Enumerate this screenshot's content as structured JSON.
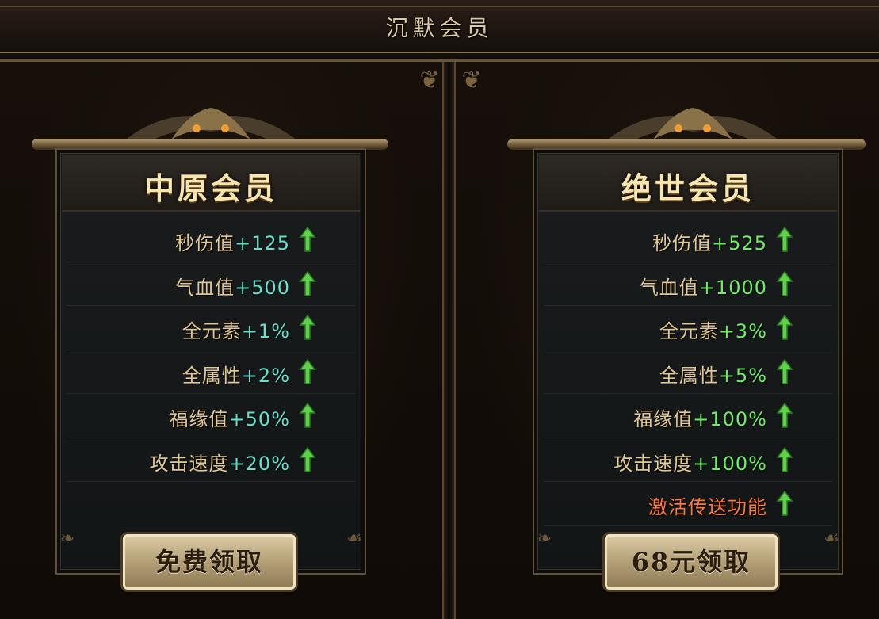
{
  "window": {
    "title": "沉默会员"
  },
  "colors": {
    "accent": "#e2c893",
    "value_cyan": "#61e3cf",
    "value_green": "#6ef065",
    "special": "#ff7a3a"
  },
  "panels": [
    {
      "title": "中原会员",
      "stats": [
        {
          "label": "秒伤值",
          "value": "+125"
        },
        {
          "label": "气血值",
          "value": "+500"
        },
        {
          "label": "全元素",
          "value": "+1%"
        },
        {
          "label": "全属性",
          "value": "+2%"
        },
        {
          "label": "福缘值",
          "value": "+50%"
        },
        {
          "label": "攻击速度",
          "value": "+20%"
        }
      ],
      "button_label": "免费领取"
    },
    {
      "title": "绝世会员",
      "stats": [
        {
          "label": "秒伤值",
          "value": "+525"
        },
        {
          "label": "气血值",
          "value": "+1000"
        },
        {
          "label": "全元素",
          "value": "+3%"
        },
        {
          "label": "全属性",
          "value": "+5%"
        },
        {
          "label": "福缘值",
          "value": "+100%"
        },
        {
          "label": "攻击速度",
          "value": "+100%"
        }
      ],
      "special_line": "激活传送功能",
      "button_label": "68元领取"
    }
  ],
  "icons": {
    "arrow": "green-up-arrow-icon"
  }
}
